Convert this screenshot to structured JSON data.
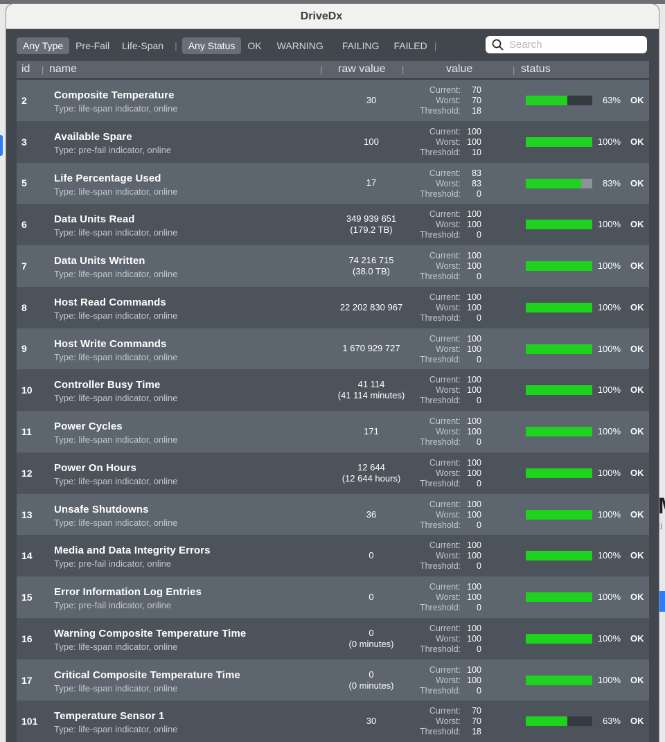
{
  "window": {
    "title": "DriveDx"
  },
  "filters": {
    "type": [
      "Any Type",
      "Pre-Fail",
      "Life-Span"
    ],
    "type_selected": 0,
    "status": [
      "Any Status",
      "OK",
      "WARNING",
      "FAILING",
      "FAILED"
    ],
    "status_selected": 0,
    "separator": "|"
  },
  "search": {
    "placeholder": "Search",
    "value": ""
  },
  "columns": {
    "id": "id",
    "name": "name",
    "raw": "raw value",
    "value": "value",
    "status": "status"
  },
  "labels": {
    "current": "Current:",
    "worst": "Worst:",
    "threshold": "Threshold:"
  },
  "colors": {
    "bar_fill": "#1ed21e",
    "window_bg": "#42474e",
    "row_odd": "#5d656e",
    "row_even": "#4c535b"
  },
  "rows": [
    {
      "id": "2",
      "name": "Composite Temperature",
      "type": "Type: life-span indicator, online",
      "raw1": "30",
      "raw2": "",
      "current": "70",
      "worst": "70",
      "threshold": "18",
      "percent": 63,
      "percent_label": "63%",
      "status": "OK"
    },
    {
      "id": "3",
      "name": "Available Spare",
      "type": "Type: pre-fail indicator, online",
      "raw1": "100",
      "raw2": "",
      "current": "100",
      "worst": "100",
      "threshold": "10",
      "percent": 100,
      "percent_label": "100%",
      "status": "OK"
    },
    {
      "id": "5",
      "name": "Life Percentage Used",
      "type": "Type: life-span indicator, online",
      "raw1": "17",
      "raw2": "",
      "current": "83",
      "worst": "83",
      "threshold": "0",
      "percent": 83,
      "percent_label": "83%",
      "status": "OK"
    },
    {
      "id": "6",
      "name": "Data Units Read",
      "type": "Type: life-span indicator, online",
      "raw1": "349 939 651",
      "raw2": "(179.2 TB)",
      "current": "100",
      "worst": "100",
      "threshold": "0",
      "percent": 100,
      "percent_label": "100%",
      "status": "OK"
    },
    {
      "id": "7",
      "name": "Data Units Written",
      "type": "Type: life-span indicator, online",
      "raw1": "74 216 715",
      "raw2": "(38.0 TB)",
      "current": "100",
      "worst": "100",
      "threshold": "0",
      "percent": 100,
      "percent_label": "100%",
      "status": "OK"
    },
    {
      "id": "8",
      "name": "Host Read Commands",
      "type": "Type: life-span indicator, online",
      "raw1": "22 202 830 967",
      "raw2": "",
      "current": "100",
      "worst": "100",
      "threshold": "0",
      "percent": 100,
      "percent_label": "100%",
      "status": "OK"
    },
    {
      "id": "9",
      "name": "Host Write Commands",
      "type": "Type: life-span indicator, online",
      "raw1": "1 670 929 727",
      "raw2": "",
      "current": "100",
      "worst": "100",
      "threshold": "0",
      "percent": 100,
      "percent_label": "100%",
      "status": "OK"
    },
    {
      "id": "10",
      "name": "Controller Busy Time",
      "type": "Type: life-span indicator, online",
      "raw1": "41 114",
      "raw2": "(41 114 minutes)",
      "current": "100",
      "worst": "100",
      "threshold": "0",
      "percent": 100,
      "percent_label": "100%",
      "status": "OK"
    },
    {
      "id": "11",
      "name": "Power Cycles",
      "type": "Type: life-span indicator, online",
      "raw1": "171",
      "raw2": "",
      "current": "100",
      "worst": "100",
      "threshold": "0",
      "percent": 100,
      "percent_label": "100%",
      "status": "OK"
    },
    {
      "id": "12",
      "name": "Power On Hours",
      "type": "Type: life-span indicator, online",
      "raw1": "12 644",
      "raw2": "(12 644 hours)",
      "current": "100",
      "worst": "100",
      "threshold": "0",
      "percent": 100,
      "percent_label": "100%",
      "status": "OK"
    },
    {
      "id": "13",
      "name": "Unsafe Shutdowns",
      "type": "Type: life-span indicator, online",
      "raw1": "36",
      "raw2": "",
      "current": "100",
      "worst": "100",
      "threshold": "0",
      "percent": 100,
      "percent_label": "100%",
      "status": "OK"
    },
    {
      "id": "14",
      "name": "Media and Data Integrity Errors",
      "type": "Type: pre-fail indicator, online",
      "raw1": "0",
      "raw2": "",
      "current": "100",
      "worst": "100",
      "threshold": "0",
      "percent": 100,
      "percent_label": "100%",
      "status": "OK"
    },
    {
      "id": "15",
      "name": "Error Information Log Entries",
      "type": "Type: pre-fail indicator, online",
      "raw1": "0",
      "raw2": "",
      "current": "100",
      "worst": "100",
      "threshold": "0",
      "percent": 100,
      "percent_label": "100%",
      "status": "OK"
    },
    {
      "id": "16",
      "name": "Warning Composite Temperature Time",
      "type": "Type: life-span indicator, online",
      "raw1": "0",
      "raw2": "(0 minutes)",
      "current": "100",
      "worst": "100",
      "threshold": "0",
      "percent": 100,
      "percent_label": "100%",
      "status": "OK"
    },
    {
      "id": "17",
      "name": "Critical Composite Temperature Time",
      "type": "Type: life-span indicator, online",
      "raw1": "0",
      "raw2": "(0 minutes)",
      "current": "100",
      "worst": "100",
      "threshold": "0",
      "percent": 100,
      "percent_label": "100%",
      "status": "OK"
    },
    {
      "id": "101",
      "name": "Temperature Sensor 1",
      "type": "Type: life-span indicator, online",
      "raw1": "30",
      "raw2": "",
      "current": "70",
      "worst": "70",
      "threshold": "18",
      "percent": 63,
      "percent_label": "63%",
      "status": "OK"
    }
  ]
}
